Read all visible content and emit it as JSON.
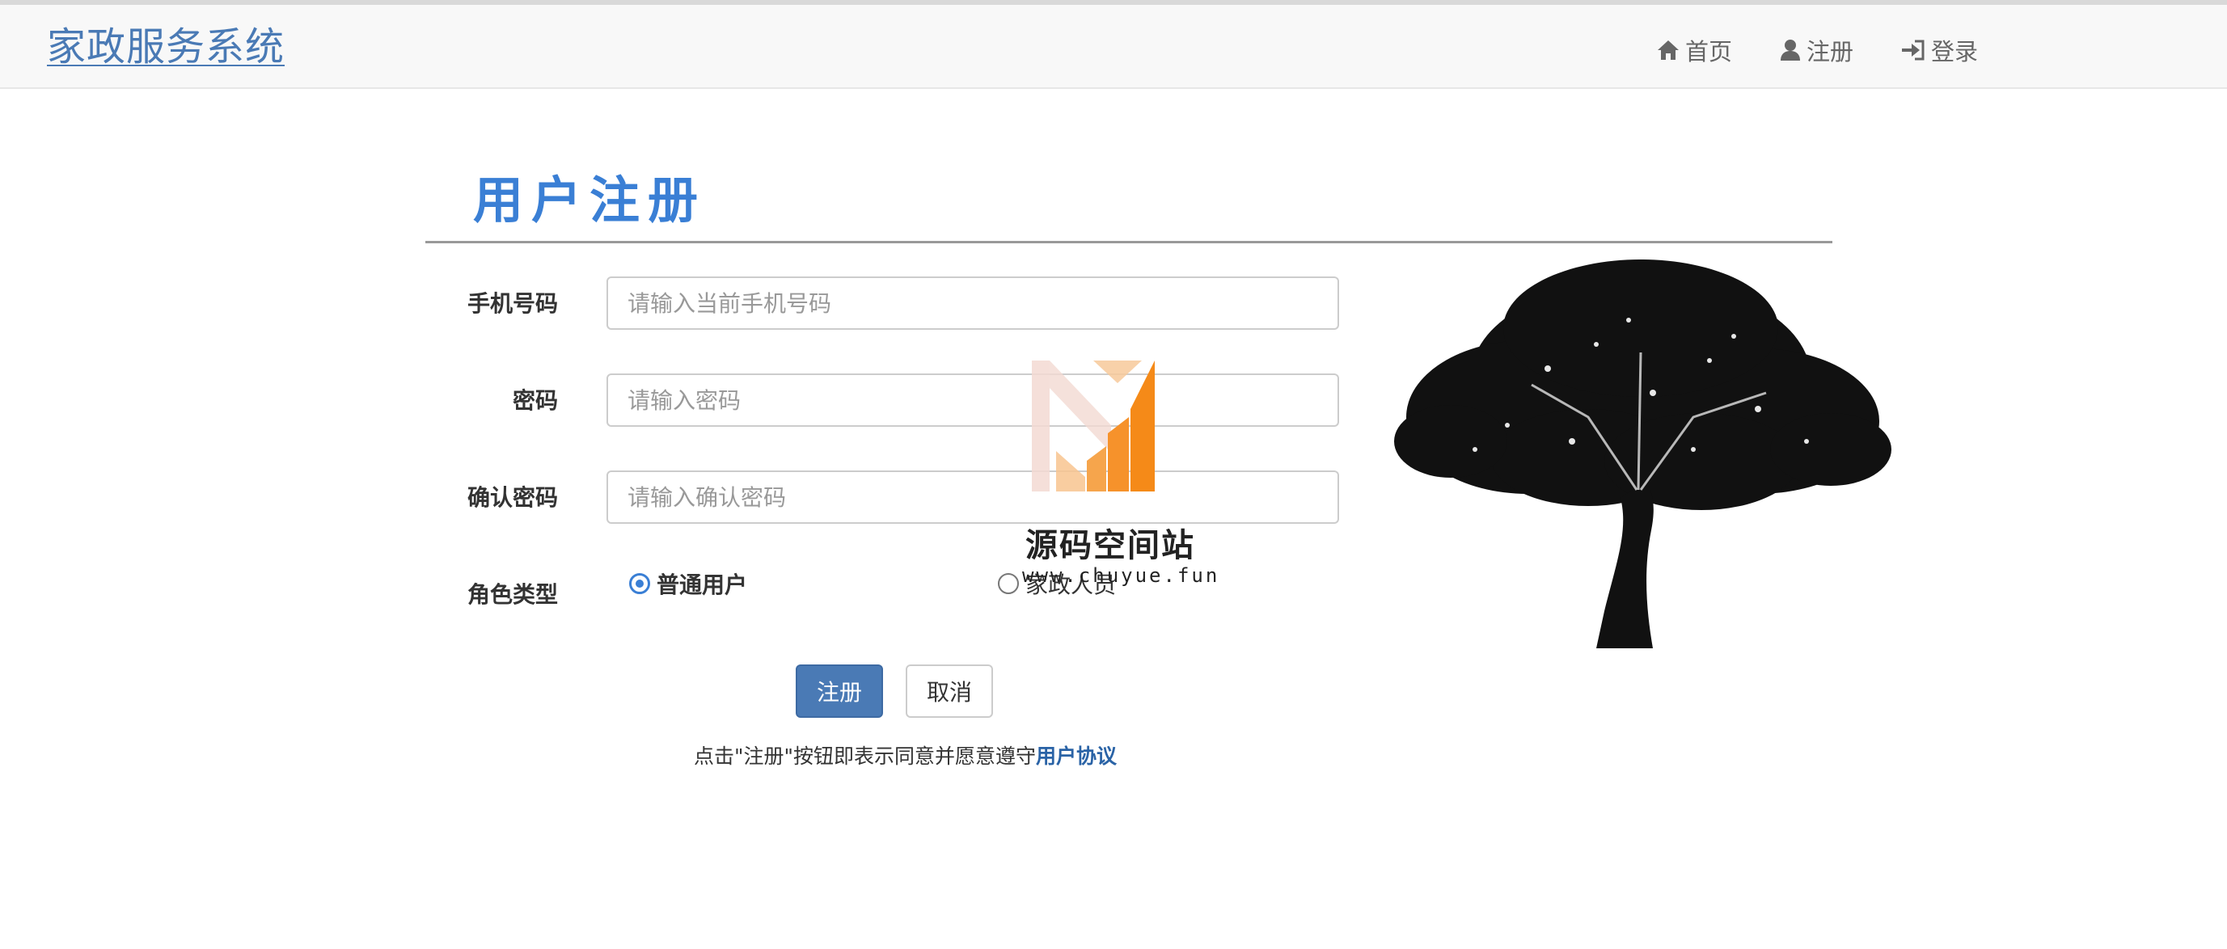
{
  "navbar": {
    "brand": "家政服务系统",
    "items": [
      {
        "label": "首页",
        "icon": "home-icon"
      },
      {
        "label": "注册",
        "icon": "user-icon"
      },
      {
        "label": "登录",
        "icon": "login-icon"
      }
    ]
  },
  "page": {
    "title": "用户注册"
  },
  "form": {
    "phone": {
      "label": "手机号码",
      "placeholder": "请输入当前手机号码",
      "value": ""
    },
    "password": {
      "label": "密码",
      "placeholder": "请输入密码",
      "value": ""
    },
    "confirm": {
      "label": "确认密码",
      "placeholder": "请输入确认密码",
      "value": ""
    },
    "role": {
      "label": "角色类型",
      "options": [
        {
          "label": "普通用户",
          "checked": true
        },
        {
          "label": "家政人员",
          "checked": false
        }
      ]
    },
    "submit_label": "注册",
    "cancel_label": "取消",
    "agreement_text": "点击\"注册\"按钮即表示同意并愿意遵守",
    "agreement_link": "用户协议"
  },
  "watermark": {
    "title": "源码空间站",
    "url": "www.chuyue.fun"
  },
  "colors": {
    "accent": "#3a7fd5",
    "brand": "#4a7ab5",
    "primary_button": "#4a7ab5"
  }
}
